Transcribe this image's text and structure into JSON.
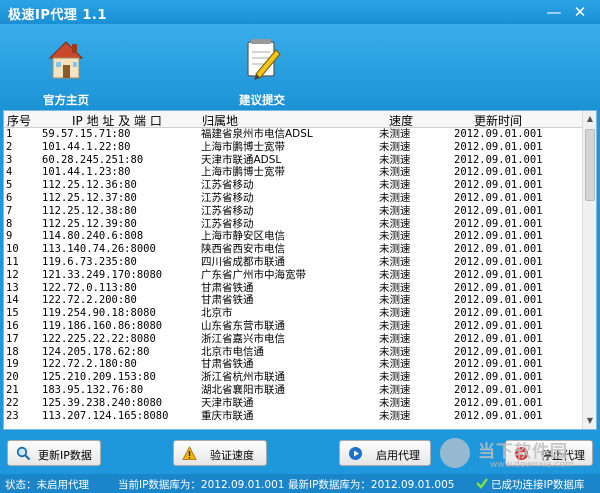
{
  "window": {
    "title": "极速IP代理 1.1",
    "minimize": "—",
    "close": "✕"
  },
  "toolbar": {
    "home_label": "官方主页",
    "suggest_label": "建议提交"
  },
  "table": {
    "headers": {
      "no": "序号",
      "ip": "IP 地 址 及 端 口",
      "loc": "归属地",
      "speed": "速度",
      "updated": "更新时间"
    },
    "rows": [
      [
        "1",
        "59.57.15.71:80",
        "福建省泉州市电信ADSL",
        "未测速",
        "2012.09.01.001"
      ],
      [
        "2",
        "101.44.1.22:80",
        "上海市鹏博士宽带",
        "未测速",
        "2012.09.01.001"
      ],
      [
        "3",
        "60.28.245.251:80",
        "天津市联通ADSL",
        "未测速",
        "2012.09.01.001"
      ],
      [
        "4",
        "101.44.1.23:80",
        "上海市鹏博士宽带",
        "未测速",
        "2012.09.01.001"
      ],
      [
        "5",
        "112.25.12.36:80",
        "江苏省移动",
        "未测速",
        "2012.09.01.001"
      ],
      [
        "6",
        "112.25.12.37:80",
        "江苏省移动",
        "未测速",
        "2012.09.01.001"
      ],
      [
        "7",
        "112.25.12.38:80",
        "江苏省移动",
        "未测速",
        "2012.09.01.001"
      ],
      [
        "8",
        "112.25.12.39:80",
        "江苏省移动",
        "未测速",
        "2012.09.01.001"
      ],
      [
        "9",
        "114.80.240.6:808",
        "上海市静安区电信",
        "未测速",
        "2012.09.01.001"
      ],
      [
        "10",
        "113.140.74.26:8000",
        "陕西省西安市电信",
        "未测速",
        "2012.09.01.001"
      ],
      [
        "11",
        "119.6.73.235:80",
        "四川省成都市联通",
        "未测速",
        "2012.09.01.001"
      ],
      [
        "12",
        "121.33.249.170:8080",
        "广东省广州市中海宽带",
        "未测速",
        "2012.09.01.001"
      ],
      [
        "13",
        "122.72.0.113:80",
        "甘肃省铁通",
        "未测速",
        "2012.09.01.001"
      ],
      [
        "14",
        "122.72.2.200:80",
        "甘肃省铁通",
        "未测速",
        "2012.09.01.001"
      ],
      [
        "15",
        "119.254.90.18:8080",
        "北京市",
        "未测速",
        "2012.09.01.001"
      ],
      [
        "16",
        "119.186.160.86:8080",
        "山东省东营市联通",
        "未测速",
        "2012.09.01.001"
      ],
      [
        "17",
        "122.225.22.22:8080",
        "浙江省嘉兴市电信",
        "未测速",
        "2012.09.01.001"
      ],
      [
        "18",
        "124.205.178.62:80",
        "北京市电信通",
        "未测速",
        "2012.09.01.001"
      ],
      [
        "19",
        "122.72.2.180:80",
        "甘肃省铁通",
        "未测速",
        "2012.09.01.001"
      ],
      [
        "20",
        "125.210.209.153:80",
        "浙江省杭州市联通",
        "未测速",
        "2012.09.01.001"
      ],
      [
        "21",
        "183.95.132.76:80",
        "湖北省襄阳市联通",
        "未测速",
        "2012.09.01.001"
      ],
      [
        "22",
        "125.39.238.240:8080",
        "天津市联通",
        "未测速",
        "2012.09.01.001"
      ],
      [
        "23",
        "113.207.124.165:8080",
        "重庆市联通",
        "未测速",
        "2012.09.01.001"
      ]
    ]
  },
  "buttons": {
    "refresh": "更新IP数据",
    "verify": "验证速度",
    "enable": "启用代理",
    "stop": "停止代理"
  },
  "watermark": {
    "line1": "当下软件园",
    "line2": "www.downxia.com"
  },
  "status": {
    "state": "状态：未启用代理",
    "current_db": "当前IP数据库为：2012.09.01.001",
    "latest_db": "最新IP数据库为：2012.09.01.005",
    "connected": "已成功连接IP数据库"
  },
  "colors": {
    "window_bg": "#1e97dc",
    "status_bg": "#1a85c9",
    "accent": "#2aa3e6"
  }
}
